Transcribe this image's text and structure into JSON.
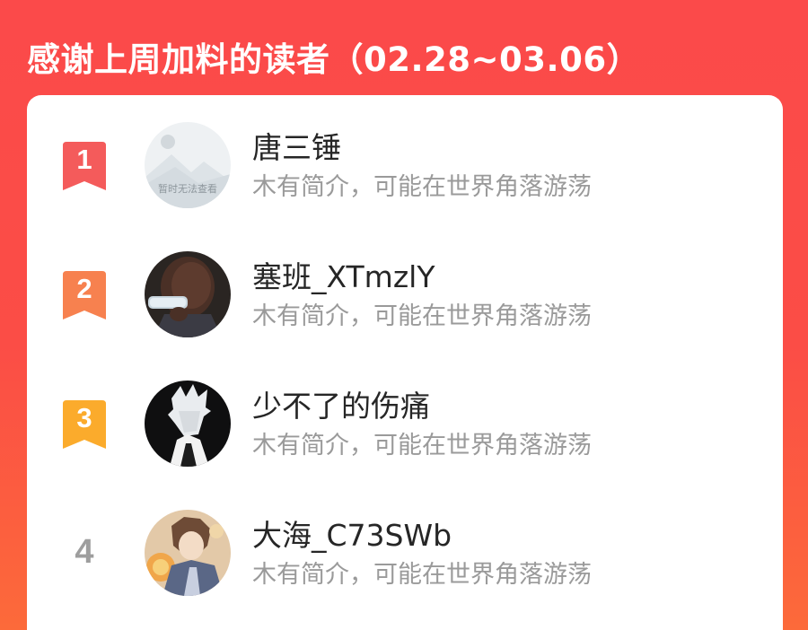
{
  "header": {
    "title": "感谢上周加料的读者（02.28~03.06）"
  },
  "readers": [
    {
      "rank": "1",
      "name": "唐三锤",
      "bio": "木有简介，可能在世界角落游荡",
      "avatar_placeholder_text": "暂时无法查看",
      "ribbon_color": "#f45b5b"
    },
    {
      "rank": "2",
      "name": "塞班_XTmzlY",
      "bio": "木有简介，可能在世界角落游荡",
      "ribbon_color": "#f7814f"
    },
    {
      "rank": "3",
      "name": "少不了的伤痛",
      "bio": "木有简介，可能在世界角落游荡",
      "ribbon_color": "#fbab2c"
    },
    {
      "rank": "4",
      "name": "大海_C73SWb",
      "bio": "木有简介，可能在世界角落游荡"
    }
  ]
}
